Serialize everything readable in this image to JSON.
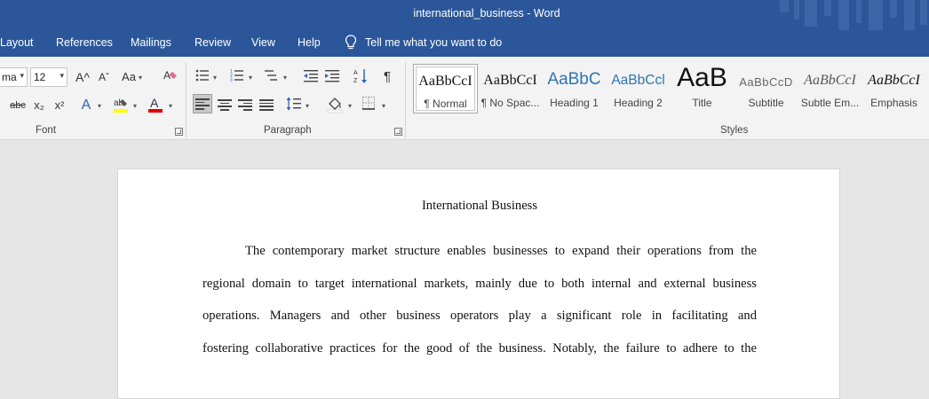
{
  "window": {
    "title": "international_business  -  Word",
    "accent": "#2b579a"
  },
  "menu": {
    "items": [
      "Layout",
      "References",
      "Mailings",
      "Review",
      "View",
      "Help"
    ],
    "tell_me": "Tell me what you want to do",
    "tell_icon": "lightbulb-icon"
  },
  "ribbon": {
    "font": {
      "label": "Font",
      "name_value": "ma",
      "size_value": "12",
      "grow_icon": "A^",
      "shrink_icon": "Aˇ",
      "case_label": "Aa",
      "strike_label": "abc",
      "sub_label": "x₂",
      "sup_label": "x²",
      "text_effect_label": "A",
      "font_color_label": "A",
      "highlight_color": "#ffff00",
      "font_color": "#e00000"
    },
    "paragraph": {
      "label": "Paragraph",
      "show_marks": "¶"
    },
    "styles": {
      "label": "Styles",
      "items": [
        {
          "sample": "AaBbCcI",
          "name": "¶ Normal"
        },
        {
          "sample": "AaBbCcI",
          "name": "¶ No Spac..."
        },
        {
          "sample": "AaBbC",
          "name": "Heading 1"
        },
        {
          "sample": "AaBbCcl",
          "name": "Heading 2"
        },
        {
          "sample": "AaB",
          "name": "Title"
        },
        {
          "sample": "AaBbCcD",
          "name": "Subtitle"
        },
        {
          "sample": "AaBbCcI",
          "name": "Subtle Em..."
        },
        {
          "sample": "AaBbCcI",
          "name": "Emphasis"
        }
      ]
    }
  },
  "document": {
    "title": "International Business",
    "lines": [
      "The contemporary market structure enables businesses to expand their operations from the",
      "regional domain to target international markets, mainly due to both internal and external business",
      "operations. Managers and other business operators play a significant role in facilitating and",
      "fostering collaborative practices for the good of the business. Notably, the failure to adhere to the"
    ]
  }
}
